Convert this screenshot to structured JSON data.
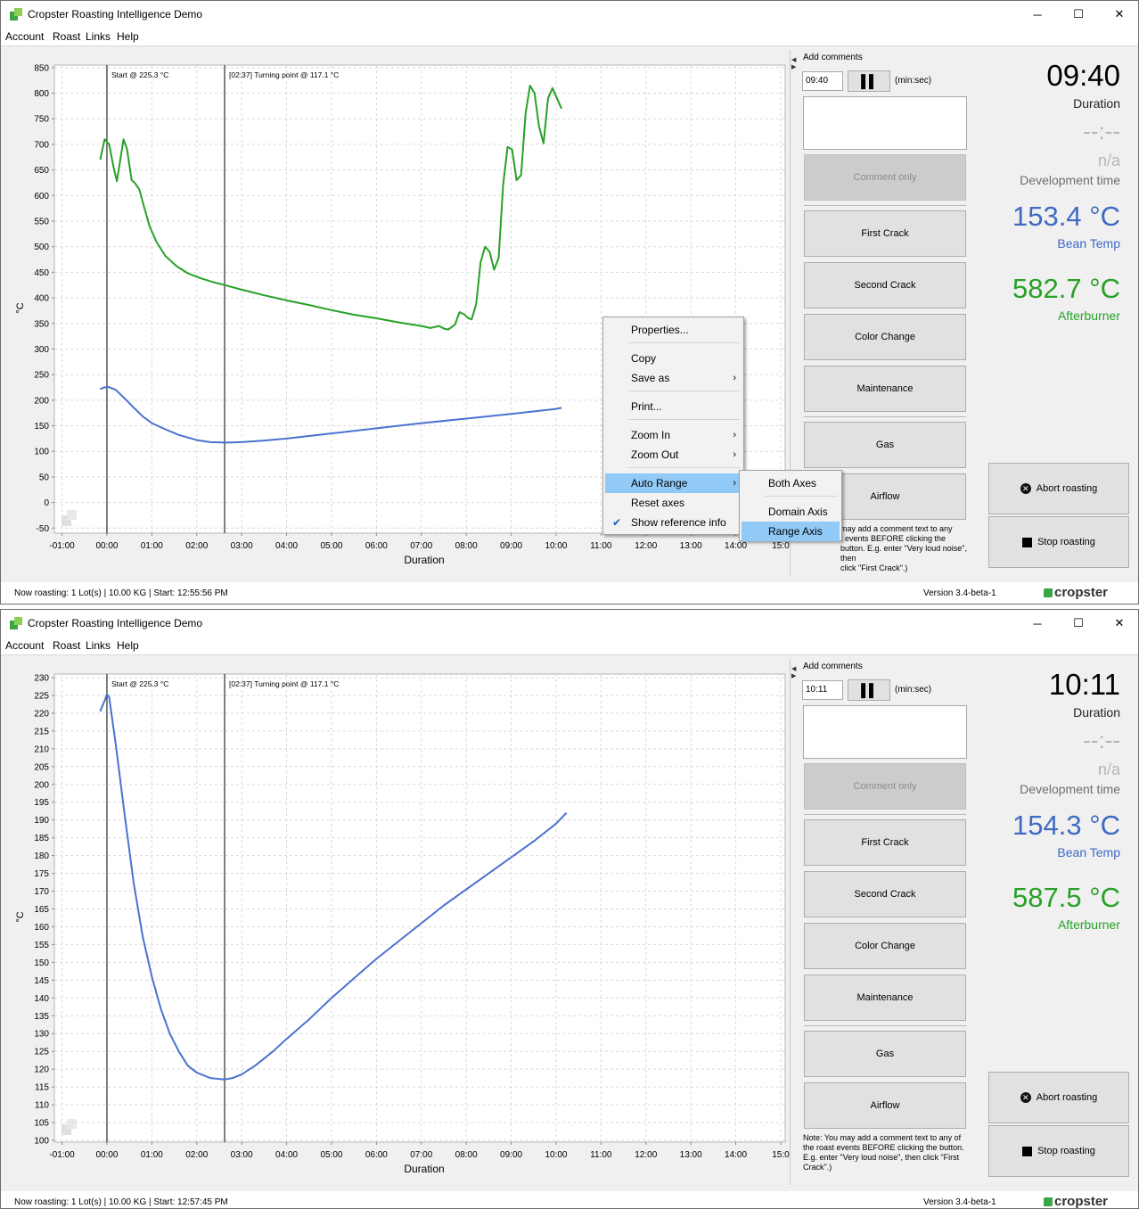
{
  "app": {
    "title": "Cropster Roasting Intelligence Demo",
    "menu": [
      "Account",
      "Roast",
      "Links",
      "Help"
    ],
    "window_controls": [
      "─",
      "☐",
      "✕"
    ],
    "brand": "cropster",
    "version": "Version 3.4-beta-1"
  },
  "panel_static": {
    "add_comments": "Add comments",
    "min_sec": "(min:sec)",
    "comment_only": "Comment only",
    "event_buttons": [
      "First Crack",
      "Second Crack",
      "Color Change",
      "Maintenance"
    ],
    "gas": "Gas",
    "airflow": "Airflow",
    "note": "Note: You may add a comment text to any of the roast events BEFORE clicking the button. E.g. enter \"Very loud noise\", then click \"First Crack\".)",
    "note_partial": "may add a comment text to any\nt events BEFORE clicking the\nbutton. E.g. enter \"Very loud noise\", then\nclick \"First Crack\".)",
    "abort": "Abort roasting",
    "stop": "Stop roasting",
    "dev_time_value": "--:--",
    "dev_time_na": "n/a",
    "dev_time_label": "Development time",
    "duration_label": "Duration",
    "bean_temp_label": "Bean Temp",
    "afterburner_label": "Afterburner"
  },
  "windows": [
    {
      "time_input": "09:40",
      "duration": "09:40",
      "bean_temp": "153.4 °C",
      "afterburner": "582.7 °C",
      "status": "Now roasting:  1 Lot(s)  |  10.00 KG  |  Start: 12:55:56 PM",
      "chart": {
        "ylabel": "°C",
        "xlabel": "Duration",
        "yticks": [
          "850",
          "800",
          "750",
          "700",
          "650",
          "600",
          "550",
          "500",
          "450",
          "400",
          "350",
          "300",
          "250",
          "200",
          "150",
          "100",
          "50",
          "0",
          "-50"
        ],
        "xticks": [
          "-01:00",
          "00:00",
          "01:00",
          "02:00",
          "03:00",
          "04:00",
          "05:00",
          "06:00",
          "07:00",
          "08:00",
          "09:00",
          "10:00",
          "11:00",
          "12:00",
          "13:00",
          "14:00",
          "15:0"
        ],
        "marker_start": "Start @ 225.3  °C",
        "marker_turning": "[02:37]  Turning point  @ 117.1  °C"
      },
      "context_menu": {
        "items": [
          "Properties...",
          "Copy",
          "Save as",
          "Print...",
          "Zoom In",
          "Zoom Out",
          "Auto Range",
          "Reset axes",
          "Show reference info"
        ],
        "submenu": [
          "Both Axes",
          "Domain Axis",
          "Range Axis"
        ]
      }
    },
    {
      "time_input": "10:11",
      "duration": "10:11",
      "bean_temp": "154.3 °C",
      "afterburner": "587.5 °C",
      "status": "Now roasting:  1 Lot(s)  |  10.00 KG  |  Start: 12:57:45 PM",
      "chart": {
        "ylabel": "°C",
        "xlabel": "Duration",
        "yticks": [
          "230",
          "225",
          "220",
          "215",
          "210",
          "205",
          "200",
          "195",
          "190",
          "185",
          "180",
          "175",
          "170",
          "165",
          "160",
          "155",
          "150",
          "145",
          "140",
          "135",
          "130",
          "125",
          "120",
          "115",
          "110",
          "105",
          "100"
        ],
        "xticks": [
          "-01:00",
          "00:00",
          "01:00",
          "02:00",
          "03:00",
          "04:00",
          "05:00",
          "06:00",
          "07:00",
          "08:00",
          "09:00",
          "10:00",
          "11:00",
          "12:00",
          "13:00",
          "14:00",
          "15:0"
        ],
        "marker_start": "Start @ 225.3  °C",
        "marker_turning": "[02:37]  Turning point  @ 117.1  °C"
      }
    }
  ],
  "chart_data": [
    {
      "type": "line",
      "xlabel": "Duration",
      "ylabel": "°C",
      "x_unit": "minutes",
      "xlim": [
        -1.17,
        15.1
      ],
      "ylim": [
        -60,
        855
      ],
      "grid": true,
      "annotations": [
        {
          "x": 0.0,
          "text": "Start @ 225.3  °C"
        },
        {
          "x": 2.62,
          "text": "[02:37]  Turning point  @ 117.1  °C"
        }
      ],
      "series": [
        {
          "color": "#27a127",
          "points": [
            [
              -0.15,
              670
            ],
            [
              -0.05,
              710
            ],
            [
              0.05,
              700
            ],
            [
              0.15,
              655
            ],
            [
              0.22,
              628
            ],
            [
              0.28,
              660
            ],
            [
              0.37,
              710
            ],
            [
              0.45,
              690
            ],
            [
              0.55,
              630
            ],
            [
              0.62,
              625
            ],
            [
              0.72,
              612
            ],
            [
              0.82,
              580
            ],
            [
              0.95,
              540
            ],
            [
              1.1,
              510
            ],
            [
              1.3,
              482
            ],
            [
              1.55,
              462
            ],
            [
              1.8,
              448
            ],
            [
              2.1,
              438
            ],
            [
              2.4,
              430
            ],
            [
              2.62,
              425
            ],
            [
              3.0,
              416
            ],
            [
              3.5,
              405
            ],
            [
              4.0,
              395
            ],
            [
              4.5,
              386
            ],
            [
              5.0,
              376
            ],
            [
              5.5,
              367
            ],
            [
              6.0,
              360
            ],
            [
              6.5,
              352
            ],
            [
              7.0,
              345
            ],
            [
              7.2,
              341
            ],
            [
              7.4,
              345
            ],
            [
              7.5,
              340
            ],
            [
              7.6,
              338
            ],
            [
              7.75,
              348
            ],
            [
              7.85,
              372
            ],
            [
              7.95,
              368
            ],
            [
              8.05,
              360
            ],
            [
              8.12,
              358
            ],
            [
              8.22,
              388
            ],
            [
              8.32,
              470
            ],
            [
              8.42,
              500
            ],
            [
              8.52,
              490
            ],
            [
              8.62,
              455
            ],
            [
              8.72,
              478
            ],
            [
              8.82,
              620
            ],
            [
              8.92,
              695
            ],
            [
              9.02,
              690
            ],
            [
              9.12,
              630
            ],
            [
              9.22,
              640
            ],
            [
              9.32,
              760
            ],
            [
              9.42,
              815
            ],
            [
              9.52,
              800
            ],
            [
              9.62,
              735
            ],
            [
              9.72,
              702
            ],
            [
              9.82,
              790
            ],
            [
              9.92,
              810
            ],
            [
              10.02,
              790
            ],
            [
              10.12,
              770
            ]
          ]
        },
        {
          "color": "#4a72d0",
          "points": [
            [
              -0.15,
              222
            ],
            [
              -0.05,
              225
            ],
            [
              0.03,
              226
            ],
            [
              0.2,
              220
            ],
            [
              0.4,
              203
            ],
            [
              0.6,
              185
            ],
            [
              0.8,
              168
            ],
            [
              1.0,
              155
            ],
            [
              1.3,
              143
            ],
            [
              1.6,
              132
            ],
            [
              2.0,
              122
            ],
            [
              2.3,
              118
            ],
            [
              2.62,
              117
            ],
            [
              3.0,
              118
            ],
            [
              3.5,
              121
            ],
            [
              4.0,
              125
            ],
            [
              5.0,
              135
            ],
            [
              6.0,
              145
            ],
            [
              7.0,
              155
            ],
            [
              8.0,
              164
            ],
            [
              9.0,
              173
            ],
            [
              10.0,
              183
            ],
            [
              10.12,
              185
            ]
          ]
        }
      ]
    },
    {
      "type": "line",
      "xlabel": "Duration",
      "ylabel": "°C",
      "x_unit": "minutes",
      "xlim": [
        -1.17,
        15.1
      ],
      "ylim": [
        99.5,
        231
      ],
      "grid": true,
      "annotations": [
        {
          "x": 0.0,
          "text": "Start @ 225.3  °C"
        },
        {
          "x": 2.62,
          "text": "[02:37]  Turning point  @ 117.1  °C"
        }
      ],
      "series": [
        {
          "color": "#4a72d0",
          "points": [
            [
              -0.15,
              220.5
            ],
            [
              -0.1,
              222
            ],
            [
              -0.05,
              223.5
            ],
            [
              0.0,
              225.3
            ],
            [
              0.05,
              224.5
            ],
            [
              0.2,
              211
            ],
            [
              0.4,
              191
            ],
            [
              0.6,
              172
            ],
            [
              0.8,
              157
            ],
            [
              1.0,
              146
            ],
            [
              1.2,
              137
            ],
            [
              1.4,
              130
            ],
            [
              1.6,
              125
            ],
            [
              1.8,
              121
            ],
            [
              2.0,
              119
            ],
            [
              2.3,
              117.5
            ],
            [
              2.62,
              117.1
            ],
            [
              2.8,
              117.5
            ],
            [
              3.0,
              118.5
            ],
            [
              3.3,
              121
            ],
            [
              3.7,
              125
            ],
            [
              4.0,
              128.5
            ],
            [
              4.5,
              134
            ],
            [
              5.0,
              140
            ],
            [
              5.5,
              145.5
            ],
            [
              6.0,
              151
            ],
            [
              6.5,
              156
            ],
            [
              7.0,
              161
            ],
            [
              7.5,
              166
            ],
            [
              8.0,
              170.5
            ],
            [
              8.5,
              175
            ],
            [
              9.0,
              179.5
            ],
            [
              9.5,
              184
            ],
            [
              10.0,
              189
            ],
            [
              10.23,
              192
            ]
          ]
        }
      ]
    }
  ]
}
